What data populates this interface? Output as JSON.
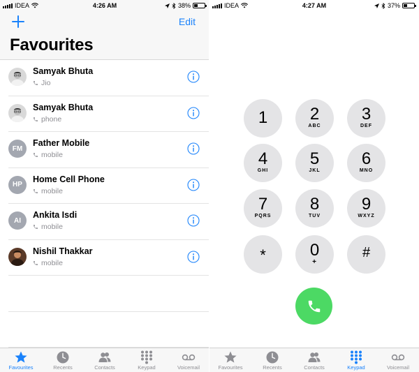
{
  "left": {
    "status_bar": {
      "carrier": "IDEA",
      "time": "4:26 AM",
      "battery": "38%",
      "battery_level": 0.38
    },
    "header": {
      "edit_label": "Edit",
      "title": "Favourites"
    },
    "favourites": [
      {
        "name": "Samyak Bhuta",
        "type": "Jio",
        "avatar_initials": ""
      },
      {
        "name": "Samyak Bhuta",
        "type": "phone",
        "avatar_initials": ""
      },
      {
        "name": "Father Mobile",
        "type": "mobile",
        "avatar_initials": "FM"
      },
      {
        "name": "Home Cell Phone",
        "type": "mobile",
        "avatar_initials": "HP"
      },
      {
        "name": "Ankita Isdi",
        "type": "mobile",
        "avatar_initials": "AI"
      },
      {
        "name": "Nishil Thakkar",
        "type": "mobile",
        "avatar_initials": ""
      }
    ],
    "tabs": [
      {
        "label": "Favourites",
        "icon": "star-icon",
        "active": true
      },
      {
        "label": "Recents",
        "icon": "clock-icon",
        "active": false
      },
      {
        "label": "Contacts",
        "icon": "contacts-icon",
        "active": false
      },
      {
        "label": "Keypad",
        "icon": "keypad-icon",
        "active": false
      },
      {
        "label": "Voicemail",
        "icon": "voicemail-icon",
        "active": false
      }
    ]
  },
  "right": {
    "status_bar": {
      "carrier": "IDEA",
      "time": "4:27 AM",
      "battery": "37%",
      "battery_level": 0.37
    },
    "keys": [
      {
        "digit": "1",
        "letters": ""
      },
      {
        "digit": "2",
        "letters": "ABC"
      },
      {
        "digit": "3",
        "letters": "DEF"
      },
      {
        "digit": "4",
        "letters": "GHI"
      },
      {
        "digit": "5",
        "letters": "JKL"
      },
      {
        "digit": "6",
        "letters": "MNO"
      },
      {
        "digit": "7",
        "letters": "PQRS"
      },
      {
        "digit": "8",
        "letters": "TUV"
      },
      {
        "digit": "9",
        "letters": "WXYZ"
      },
      {
        "digit": "*",
        "letters": ""
      },
      {
        "digit": "0",
        "letters": "+"
      },
      {
        "digit": "#",
        "letters": ""
      }
    ],
    "tabs": [
      {
        "label": "Favourites",
        "icon": "star-icon",
        "active": false
      },
      {
        "label": "Recents",
        "icon": "clock-icon",
        "active": false
      },
      {
        "label": "Contacts",
        "icon": "contacts-icon",
        "active": false
      },
      {
        "label": "Keypad",
        "icon": "keypad-icon",
        "active": true
      },
      {
        "label": "Voicemail",
        "icon": "voicemail-icon",
        "active": false
      }
    ]
  },
  "colors": {
    "accent": "#1a82fb",
    "call_green": "#4cd964",
    "key_gray": "#e4e4e6",
    "inactive_gray": "#8e8e93"
  }
}
